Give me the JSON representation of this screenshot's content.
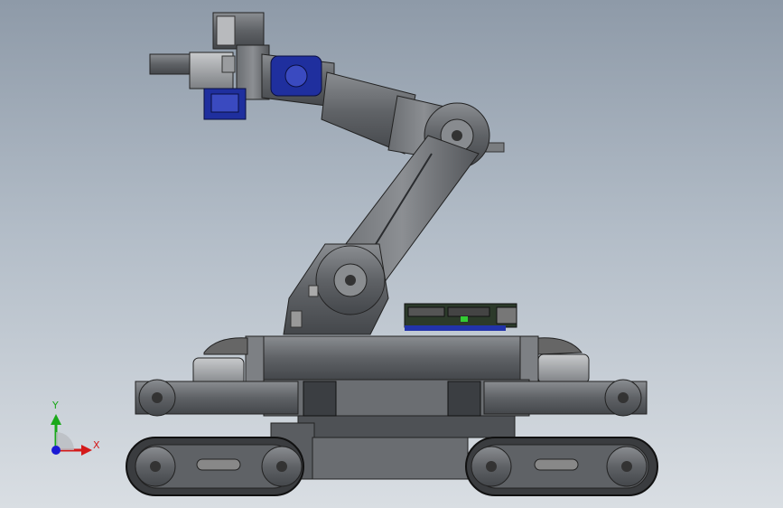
{
  "viewport": {
    "background_top": "#8e9aa8",
    "background_bottom": "#d9dee3"
  },
  "model": {
    "body_color": "#5c5f63",
    "servo_color": "#1f2f9e",
    "pcb_color": "#2c3a2a"
  },
  "triad": {
    "x_label": "X",
    "y_label": "Y",
    "x_color": "#d41a1a",
    "y_color": "#1aa81a",
    "z_color": "#1a1ad4"
  }
}
